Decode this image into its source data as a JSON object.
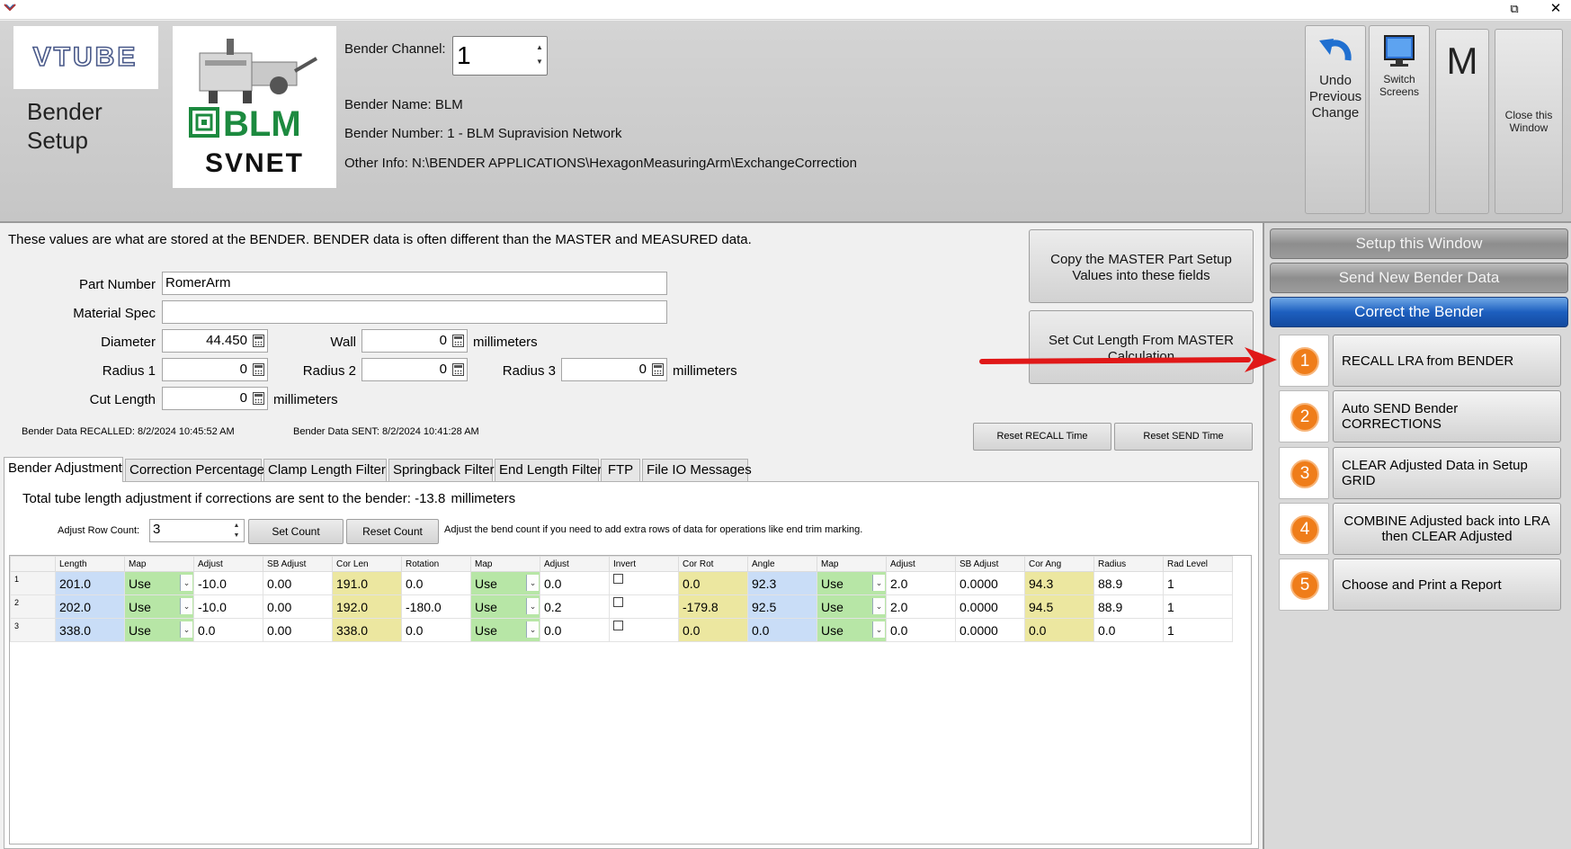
{
  "window": {
    "restore_glyph": "⧉",
    "close_glyph": "✕"
  },
  "header": {
    "logo_text": "VTUBE",
    "title": "Bender Setup",
    "blm_logo_text": "BLM",
    "blm_logo_subtext": "SVNET",
    "channel_label": "Bender Channel:",
    "channel_value": "1",
    "bender_name": "Bender Name:  BLM",
    "bender_number": "Bender Number:  1 - BLM Supravision Network",
    "other_info": "Other Info:  N:\\BENDER APPLICATIONS\\HexagonMeasuringArm\\ExchangeCorrection",
    "undo_label": "Undo Previous Change",
    "switch_label": "Switch Screens",
    "m_label": "M",
    "close_label": "Close this Window"
  },
  "right_panel": {
    "setup_window": "Setup this Window",
    "send_new": "Send New Bender Data",
    "correct": "Correct the Bender",
    "steps": [
      {
        "num": "1",
        "label": "RECALL LRA from BENDER"
      },
      {
        "num": "2",
        "label": "Auto SEND Bender CORRECTIONS"
      },
      {
        "num": "3",
        "label": "CLEAR Adjusted Data in Setup GRID"
      },
      {
        "num": "4",
        "label": "COMBINE Adjusted back into LRA then CLEAR Adjusted"
      },
      {
        "num": "5",
        "label": "Choose and Print a Report"
      }
    ]
  },
  "main": {
    "note": "These values are what are stored at the BENDER.  BENDER data is often different than the MASTER and MEASURED data.",
    "part_number_label": "Part Number",
    "part_number_value": "RomerArm",
    "material_spec_label": "Material Spec",
    "material_spec_value": "",
    "diameter_label": "Diameter",
    "diameter_value": "44.450",
    "wall_label": "Wall",
    "wall_value": "0",
    "radius1_label": "Radius 1",
    "radius1_value": "0",
    "radius2_label": "Radius 2",
    "radius2_value": "0",
    "radius3_label": "Radius 3",
    "radius3_value": "0",
    "cut_length_label": "Cut Length",
    "cut_length_value": "0",
    "unit": "millimeters",
    "copy_master_btn": "Copy the MASTER Part Setup Values into these fields",
    "set_cut_btn": "Set Cut Length From MASTER Calculation",
    "recalled_text": "Bender Data RECALLED:  8/2/2024 10:45:52 AM",
    "sent_text": "Bender Data SENT:  8/2/2024 10:41:28 AM",
    "reset_recall_btn": "Reset RECALL Time",
    "reset_send_btn": "Reset SEND Time"
  },
  "tabs": [
    "Bender Adjustment",
    "Correction Percentage",
    "Clamp Length Filter",
    "Springback Filter",
    "End Length Filter",
    "FTP",
    "File IO Messages"
  ],
  "adjust": {
    "total_text": "Total tube length adjustment if corrections are sent to the bender:  -13.8",
    "total_unit": "millimeters",
    "row_count_label": "Adjust Row Count:",
    "row_count_value": "3",
    "set_count_btn": "Set Count",
    "reset_count_btn": "Reset Count",
    "hint": "Adjust the bend count if you need to add extra rows of data for operations like end trim marking."
  },
  "grid": {
    "columns": [
      "",
      "Length",
      "Map",
      "Adjust",
      "SB Adjust",
      "Cor Len",
      "Rotation",
      "Map",
      "Adjust",
      "Invert",
      "Cor Rot",
      "Angle",
      "Map",
      "Adjust",
      "SB Adjust",
      "Cor Ang",
      "Radius",
      "Rad Level"
    ],
    "rows": [
      [
        "1",
        "201.0",
        "Use",
        "-10.0",
        "0.00",
        "191.0",
        "0.0",
        "Use",
        "0.0",
        "",
        "0.0",
        "92.3",
        "Use",
        "2.0",
        "0.0000",
        "94.3",
        "88.9",
        "1"
      ],
      [
        "2",
        "202.0",
        "Use",
        "-10.0",
        "0.00",
        "192.0",
        "-180.0",
        "Use",
        "0.2",
        "",
        "-179.8",
        "92.5",
        "Use",
        "2.0",
        "0.0000",
        "94.5",
        "88.9",
        "1"
      ],
      [
        "3",
        "338.0",
        "Use",
        "0.0",
        "0.00",
        "338.0",
        "0.0",
        "Use",
        "0.0",
        "",
        "0.0",
        "0.0",
        "Use",
        "0.0",
        "0.0000",
        "0.0",
        "0.0",
        "1"
      ]
    ]
  },
  "colors": {
    "accent_orange": "#ef7d1a",
    "correct_blue": "#1d5fbf",
    "cell_blue": "#c9ddf7",
    "cell_yellow": "#ece7a0",
    "cell_green": "#b7e6a6",
    "arrow_red": "#e01818"
  }
}
